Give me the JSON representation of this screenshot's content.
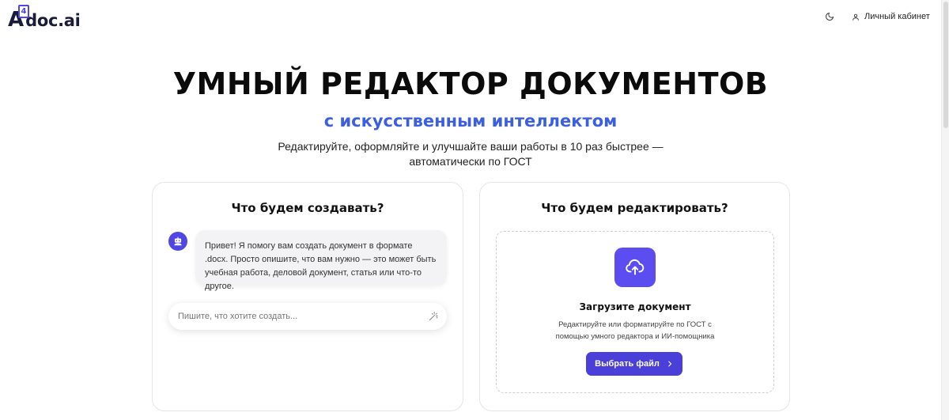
{
  "header": {
    "logo_a": "A",
    "logo_digit": "4",
    "logo_rest": "doc.ai",
    "account_label": "Личный кабинет"
  },
  "icons": {
    "theme": "moon-icon",
    "account": "user-icon",
    "bot": "robot-icon",
    "magic": "magic-wand-icon",
    "upload": "cloud-upload-icon",
    "chevron": "chevron-right-icon"
  },
  "colors": {
    "accent": "#4f46e5",
    "subtitle": "#3b5fe0",
    "button": "#4a3fd8"
  },
  "hero": {
    "title": "УМНЫЙ РЕДАКТОР ДОКУМЕНТОВ",
    "subtitle": "с искусственным интеллектом",
    "description": "Редактируйте, оформляйте и улучшайте ваши работы в 10 раз быстрее — автоматически по ГОСТ"
  },
  "create": {
    "title": "Что будем создавать?",
    "bot_message": "Привет! Я помогу вам создать документ в формате .docx. Просто опишите, что вам нужно — это может быть учебная работа, деловой документ, статья или что-то другое.",
    "input_placeholder": "Пишите, что хотите создать..."
  },
  "edit": {
    "title": "Что будем редактировать?",
    "upload_title": "Загрузите документ",
    "upload_description": "Редактируйте или форматируйте по ГОСТ с помощью умного редактора и ИИ-помощника",
    "button_label": "Выбрать файл"
  }
}
